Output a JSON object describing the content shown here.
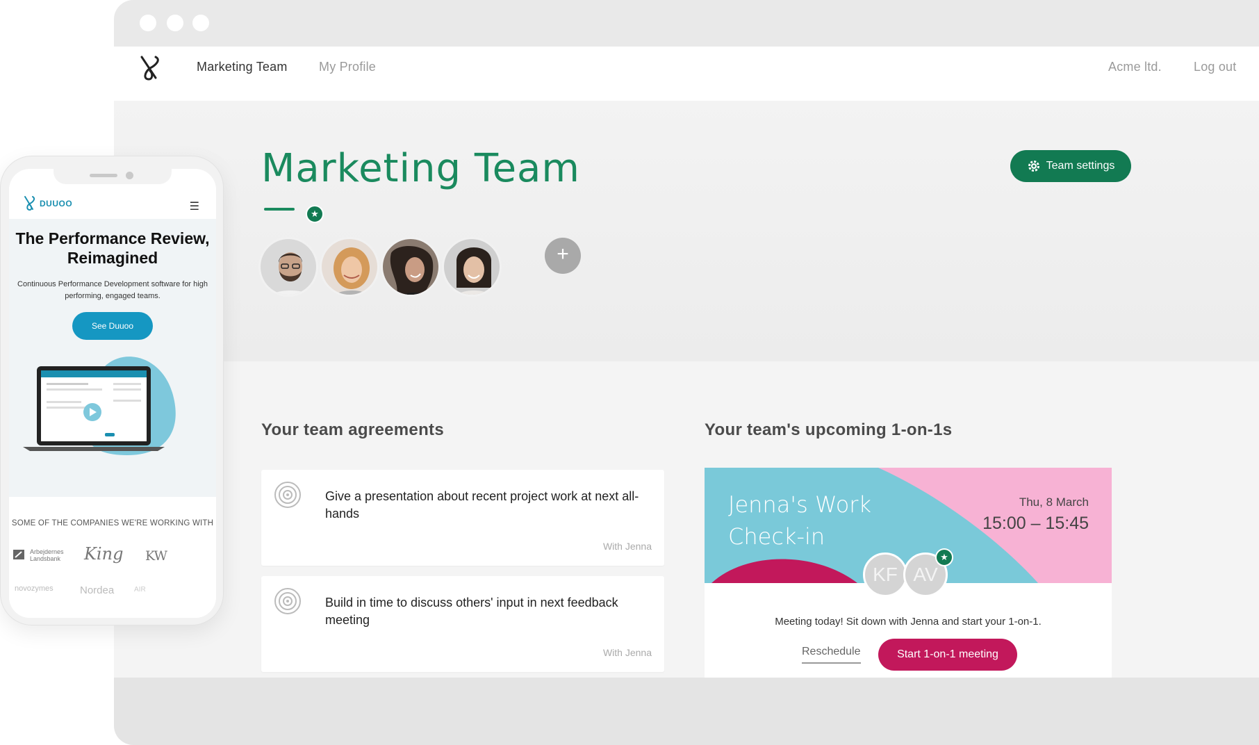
{
  "nav": {
    "team_link": "Marketing Team",
    "profile_link": "My Profile",
    "company": "Acme ltd.",
    "logout": "Log out"
  },
  "page": {
    "title": "Marketing Team",
    "settings_button": "Team settings",
    "add_member": "+"
  },
  "agreements": {
    "title": "Your team agreements",
    "items": [
      {
        "text": "Give a presentation about recent project work at next all-hands",
        "with": "With Jenna"
      },
      {
        "text": "Build in time to discuss others' input in next feedback meeting",
        "with": "With Jenna"
      }
    ]
  },
  "one_on_ones": {
    "title": "Your team's upcoming 1-on-1s",
    "meeting_title": "Jenna's Work Check-in",
    "date": "Thu, 8 March",
    "time": "15:00 – 15:45",
    "attendees": [
      "KF",
      "AV"
    ],
    "message": "Meeting today! Sit down with Jenna and start your 1-on-1.",
    "reschedule": "Reschedule",
    "start": "Start 1-on-1 meeting"
  },
  "phone": {
    "brand": "DUUOO",
    "headline": "The Performance Review, Reimagined",
    "subtext": "Continuous Performance Development software for high performing, engaged teams.",
    "cta": "See Duuoo",
    "companies_title": "SOME OF THE COMPANIES WE'RE WORKING WITH",
    "company_logos": [
      "Arbejdernes Landsbank",
      "King",
      "KW",
      "novozymes",
      "Nordea",
      "AIR"
    ]
  },
  "colors": {
    "brand_green": "#127a52",
    "title_green": "#1a8a5e",
    "meeting_blue": "#7ac9d9",
    "meeting_pink": "#f7b2d4",
    "start_magenta": "#c2185b",
    "phone_blue": "#1597c2"
  }
}
